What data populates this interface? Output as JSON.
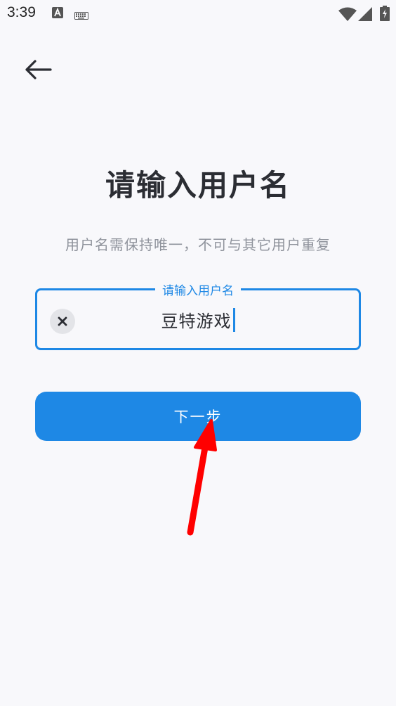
{
  "status_bar": {
    "time": "3:39",
    "icons": [
      "a-keyboard-icon",
      "keyboard-icon",
      "wifi-icon",
      "signal-icon",
      "battery-icon"
    ]
  },
  "header": {
    "back_icon": "arrow-left-icon"
  },
  "main": {
    "title": "请输入用户名",
    "subtitle": "用户名需保持唯一，不可与其它用户重复",
    "input": {
      "label": "请输入用户名",
      "value": "豆特游戏",
      "clear_icon": "close-icon"
    },
    "next_button": {
      "label": "下一步"
    }
  },
  "annotation": {
    "arrow_color": "#ff0000"
  },
  "colors": {
    "accent": "#1e88e5",
    "background": "#f8f8fb",
    "title": "#2b2d33",
    "subtitle": "#8f939c"
  }
}
